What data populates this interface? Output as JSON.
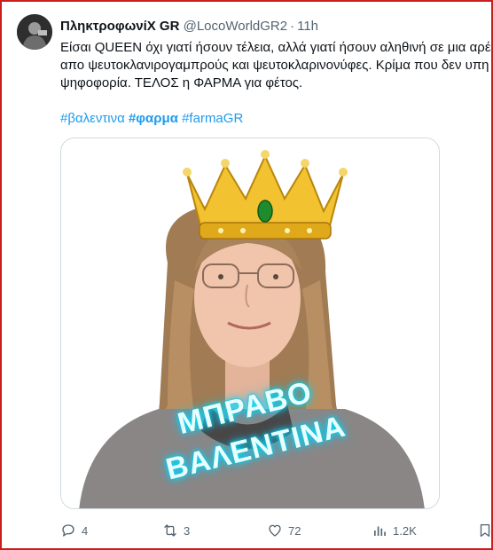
{
  "tweet": {
    "author_name": "ΠληκτροφωνίΧ GR",
    "handle": "@LocoWorldGR2",
    "time": "11h",
    "text_lines": [
      "Είσαι QUEEN όχι γιατί ήσουν τέλεια, αλλά γιατί ήσουν αληθινή σε μια αρέ",
      "απο ψευτοκλανιρογαμπρούς και ψευτοκλαρινονύφες. Κρίμα που δεν υπη",
      "ψηφοφορία. ΤΕΛΟΣ η ΦΑΡΜΑ για φέτος."
    ],
    "hashtags": [
      "#βαλεντινα",
      "#φαρμα",
      "#farmaGR"
    ]
  },
  "media": {
    "overlay_line1": "ΜΠΡΑΒΟ",
    "overlay_line2": "ΒΑΛΕΝΤΙΝΑ"
  },
  "actions": {
    "reply_count": "4",
    "retweet_count": "3",
    "like_count": "72",
    "views_count": "1.2K"
  },
  "colors": {
    "link": "#1d9bf0",
    "secondary_text": "#536471",
    "border_frame": "#c81e1e",
    "glow": "#00e5ff"
  },
  "icons": [
    "avatar",
    "crown-icon",
    "reply-icon",
    "retweet-icon",
    "like-icon",
    "views-icon",
    "bookmark-icon"
  ]
}
